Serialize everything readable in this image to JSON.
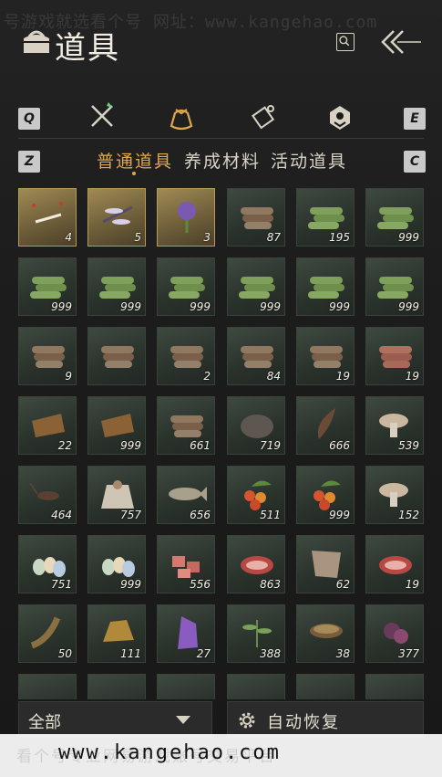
{
  "header": {
    "title": "道具",
    "watermark_top": "号游戏就选看个号  网址：www.kangehao.com"
  },
  "keys": {
    "q": "Q",
    "e": "E",
    "z": "Z",
    "c": "C"
  },
  "categories": [
    {
      "icon": "crossed-swords-icon"
    },
    {
      "icon": "pouch-icon",
      "active": true
    },
    {
      "icon": "scroll-icon"
    },
    {
      "icon": "gem-badge-icon"
    }
  ],
  "subtabs": [
    {
      "label": "普通道具",
      "active": true
    },
    {
      "label": "养成材料"
    },
    {
      "label": "活动道具"
    }
  ],
  "colors": {
    "accent": "#e0a64a",
    "rare_slot": "#b89a58",
    "common_slot": "#3e4a40"
  },
  "items": [
    {
      "icon": "dragonfly-swarm-icon",
      "qty": "4",
      "rare": true
    },
    {
      "icon": "dragonfly-icon",
      "qty": "5",
      "rare": true
    },
    {
      "icon": "purple-flower-icon",
      "qty": "3",
      "rare": true
    },
    {
      "icon": "wood-logs-icon",
      "qty": "87"
    },
    {
      "icon": "bamboo-bundle-icon",
      "qty": "195"
    },
    {
      "icon": "bamboo-bundle-icon",
      "qty": "999"
    },
    {
      "icon": "bamboo-bundle-icon",
      "qty": "999"
    },
    {
      "icon": "bamboo-bundle-icon",
      "qty": "999"
    },
    {
      "icon": "bamboo-bundle-icon",
      "qty": "999"
    },
    {
      "icon": "bamboo-bundle-icon",
      "qty": "999"
    },
    {
      "icon": "bamboo-bundle-icon",
      "qty": "999"
    },
    {
      "icon": "bamboo-bundle-icon",
      "qty": "999"
    },
    {
      "icon": "log-pile-icon",
      "qty": "9"
    },
    {
      "icon": "log-pile-icon",
      "qty": ""
    },
    {
      "icon": "log-pile-icon",
      "qty": "2"
    },
    {
      "icon": "log-pile-icon",
      "qty": "84"
    },
    {
      "icon": "log-pile-icon",
      "qty": "19"
    },
    {
      "icon": "red-log-pile-icon",
      "qty": "19"
    },
    {
      "icon": "bark-icon",
      "qty": "22"
    },
    {
      "icon": "bark-icon",
      "qty": "999"
    },
    {
      "icon": "charcoal-logs-icon",
      "qty": "661"
    },
    {
      "icon": "stone-icon",
      "qty": "719"
    },
    {
      "icon": "feather-icon",
      "qty": "666"
    },
    {
      "icon": "mushrooms-icon",
      "qty": "539"
    },
    {
      "icon": "cricket-icon",
      "qty": "464"
    },
    {
      "icon": "grain-sack-icon",
      "qty": "757"
    },
    {
      "icon": "fish-icon",
      "qty": "656"
    },
    {
      "icon": "berries-icon",
      "qty": "511"
    },
    {
      "icon": "berries-icon",
      "qty": "999"
    },
    {
      "icon": "white-mushroom-icon",
      "qty": "152"
    },
    {
      "icon": "eggs-icon",
      "qty": "751"
    },
    {
      "icon": "eggs-icon",
      "qty": "999"
    },
    {
      "icon": "meat-chunks-icon",
      "qty": "556"
    },
    {
      "icon": "steak-icon",
      "qty": "863"
    },
    {
      "icon": "hide-icon",
      "qty": "62"
    },
    {
      "icon": "steak-icon",
      "qty": "19"
    },
    {
      "icon": "eel-icon",
      "qty": "50"
    },
    {
      "icon": "gold-ore-icon",
      "qty": "111"
    },
    {
      "icon": "amethyst-icon",
      "qty": "27"
    },
    {
      "icon": "herb-icon",
      "qty": "388"
    },
    {
      "icon": "mortar-bowl-icon",
      "qty": "38"
    },
    {
      "icon": "purple-petals-icon",
      "qty": "377"
    }
  ],
  "filter": {
    "value": "全部"
  },
  "auto_restore": {
    "label": "自动恢复"
  },
  "watermark_bottom": {
    "faint": "看个号专业网易游戏账号交易平台",
    "url": "www.kangehao.com"
  }
}
